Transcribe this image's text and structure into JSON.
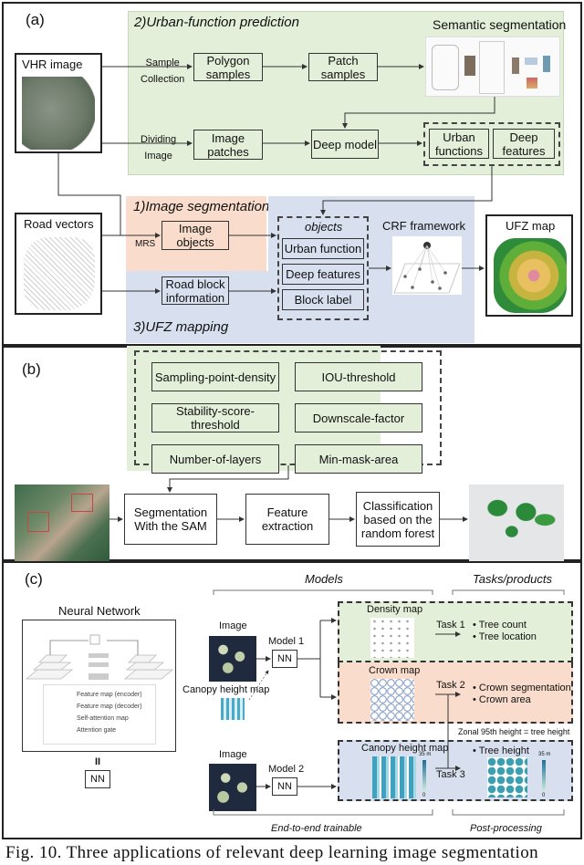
{
  "panel_a": {
    "label": "(a)",
    "section_urban": "2)Urban-function prediction",
    "section_segmentation": "1)Image segmentation",
    "section_mapping": "3)UFZ mapping",
    "vhr_title": "VHR image",
    "road_title": "Road vectors",
    "sample_collection": [
      "Sample",
      "Collection"
    ],
    "dividing_image": [
      "Dividing",
      "Image"
    ],
    "polygon_samples": "Polygon samples",
    "patch_samples": "Patch samples",
    "semantic_segmentation": "Semantic segmentation",
    "image_patches": "Image patches",
    "deep_model": "Deep model",
    "urban_functions": "Urban functions",
    "deep_features_out": "Deep features",
    "mrs": "MRS",
    "image_objects": "Image objects",
    "road_block": "Road block information",
    "objects_title": "objects",
    "objects_items": [
      "Urban function",
      "Deep features",
      "Block label"
    ],
    "crf": "CRF framework",
    "ufz_map": "UFZ map"
  },
  "panel_b": {
    "label": "(b)",
    "params": [
      "Sampling-point-density",
      "IOU-threshold",
      "Stability-score-threshold",
      "Downscale-factor",
      "Number-of-layers",
      "Min-mask-area"
    ],
    "segmentation": "Segmentation With the SAM",
    "feature_extraction": "Feature extraction",
    "classification": "Classification based on the random forest"
  },
  "panel_c": {
    "label": "(c)",
    "neural_network": "Neural Network",
    "legend": [
      "Feature map (encoder)",
      "Feature map (decoder)",
      "Self-attention map",
      "Attention gate"
    ],
    "equals": "II",
    "nn": "NN",
    "models_header": "Models",
    "tasks_header": "Tasks/products",
    "image_1": "Image",
    "image_2": "Image",
    "canopy_input": "Canopy height map",
    "model_1": "Model 1",
    "model_2": "Model 2",
    "density_map": "Density map",
    "crown_map": "Crown map",
    "canopy_map": "Canopy height map",
    "task_1": "Task 1",
    "task_2": "Task 2",
    "task_3": "Task 3",
    "task1_items": [
      "• Tree count",
      "• Tree location"
    ],
    "task2_items": [
      "• Crown segmentation",
      "• Crown area"
    ],
    "task3_item": "• Tree height",
    "zonal": "Zonal 95th height = tree height",
    "scale_max": "35 m",
    "scale_min": "0",
    "end_to_end": "End-to-end trainable",
    "post_processing": "Post-processing"
  },
  "caption": "Fig. 10.  Three applications of relevant deep learning image segmentation"
}
